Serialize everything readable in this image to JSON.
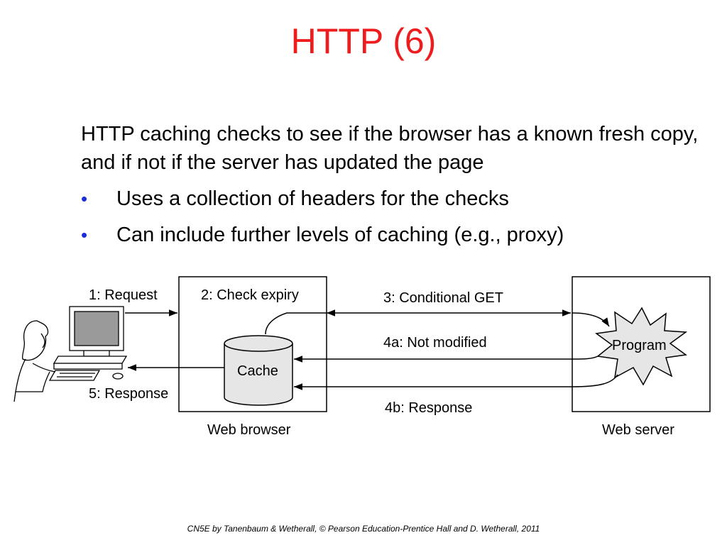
{
  "slide": {
    "title": "HTTP (6)",
    "intro": "HTTP caching checks to see if the browser has a known fresh copy, and if not if the server has updated the page",
    "bullets": [
      "Uses a collection of headers for the checks",
      "Can include further levels of caching (e.g., proxy)"
    ],
    "footer": "CN5E by Tanenbaum & Wetherall, © Pearson Education-Prentice Hall and D. Wetherall, 2011"
  },
  "diagram": {
    "labels": {
      "request": "1: Request",
      "check_expiry": "2: Check expiry",
      "conditional_get": "3: Conditional GET",
      "not_modified": "4a: Not modified",
      "response_4b": "4b: Response",
      "response_5": "5: Response",
      "cache": "Cache",
      "program": "Program",
      "web_browser": "Web browser",
      "web_server": "Web server"
    }
  },
  "colors": {
    "title": "#ee1c1c",
    "bullet": "#1a2dd6"
  }
}
